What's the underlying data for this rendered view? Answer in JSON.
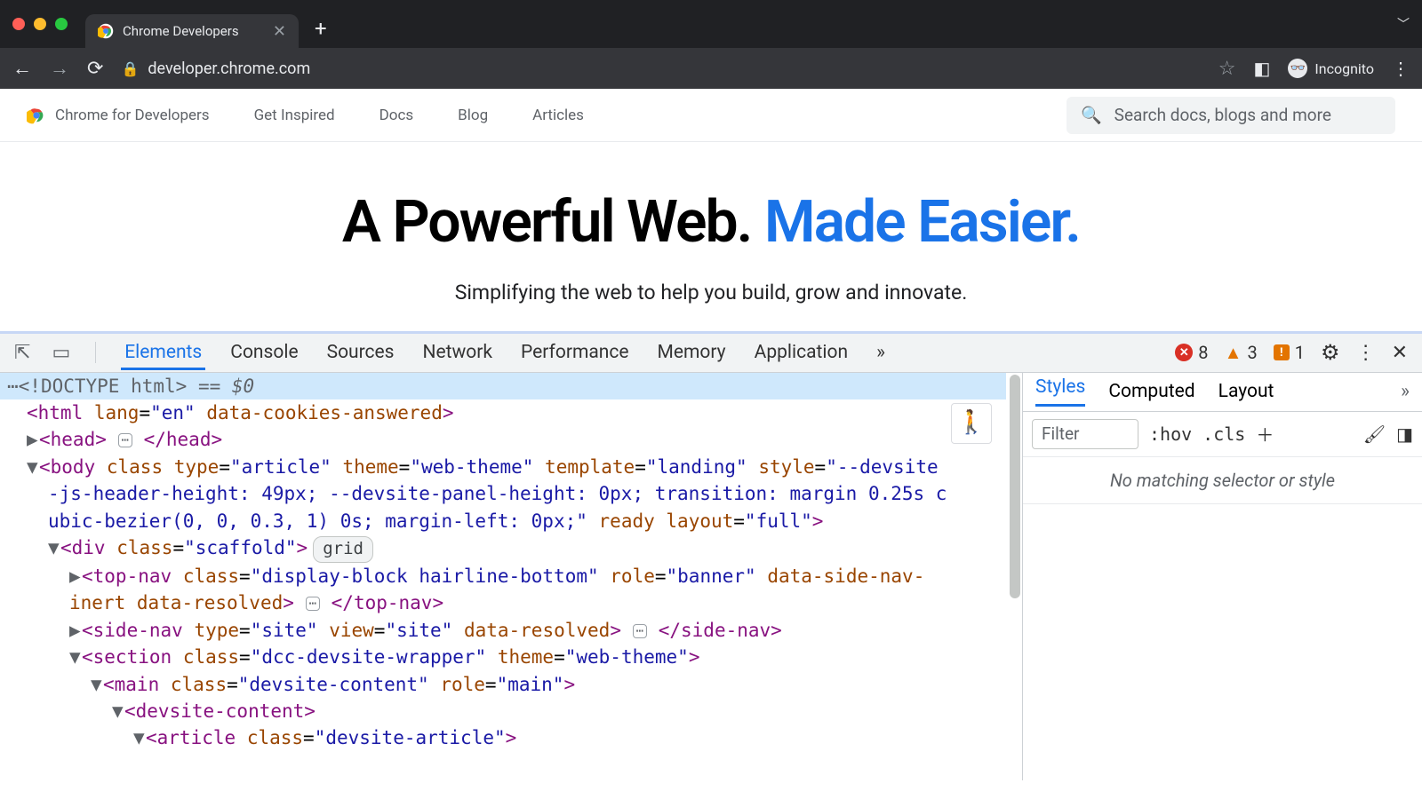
{
  "chrome": {
    "tab_title": "Chrome Developers",
    "url": "developer.chrome.com",
    "incognito_label": "Incognito"
  },
  "site": {
    "brand": "Chrome for Developers",
    "nav": [
      "Get Inspired",
      "Docs",
      "Blog",
      "Articles"
    ],
    "search_placeholder": "Search docs, blogs and more"
  },
  "hero": {
    "title_black": "A Powerful Web. ",
    "title_blue": "Made Easier.",
    "subtitle": "Simplifying the web to help you build, grow and innovate."
  },
  "devtools": {
    "tabs": [
      "Elements",
      "Console",
      "Sources",
      "Network",
      "Performance",
      "Memory",
      "Application"
    ],
    "overflow": "»",
    "errors": "8",
    "warnings": "3",
    "issues": "1",
    "styles_tabs": [
      "Styles",
      "Computed",
      "Layout"
    ],
    "filter_placeholder": "Filter",
    "hov": ":hov",
    "cls": ".cls",
    "no_match": "No matching selector or style",
    "grid_badge": "grid",
    "selected_marker": "== ",
    "dollar": "$0",
    "dom": {
      "doctype": "<!DOCTYPE html>",
      "html_open": "<html lang=\"en\" data-cookies-answered>",
      "head": "<head>",
      "head_close": "</head>",
      "body_open_1": "<body class type=\"article\" theme=\"web-theme\" template=\"landing\" style=\"--devsite",
      "body_open_2": "-js-header-height: 49px; --devsite-panel-height: 0px; transition: margin 0.25s c",
      "body_open_3": "ubic-bezier(0, 0, 0.3, 1) 0s; margin-left: 0px;\" ready layout=\"full\">",
      "div_scaffold": "<div class=\"scaffold\">",
      "topnav_1": "<top-nav class=\"display-block hairline-bottom\" role=\"banner\" data-side-nav-",
      "topnav_2": "inert data-resolved>",
      "topnav_close": "</top-nav>",
      "sidenav": "<side-nav type=\"site\" view=\"site\" data-resolved>",
      "sidenav_close": "</side-nav>",
      "section": "<section class=\"dcc-devsite-wrapper\" theme=\"web-theme\">",
      "main": "<main class=\"devsite-content\" role=\"main\">",
      "devsite_content": "<devsite-content>",
      "article": "<article class=\"devsite-article\">"
    }
  }
}
